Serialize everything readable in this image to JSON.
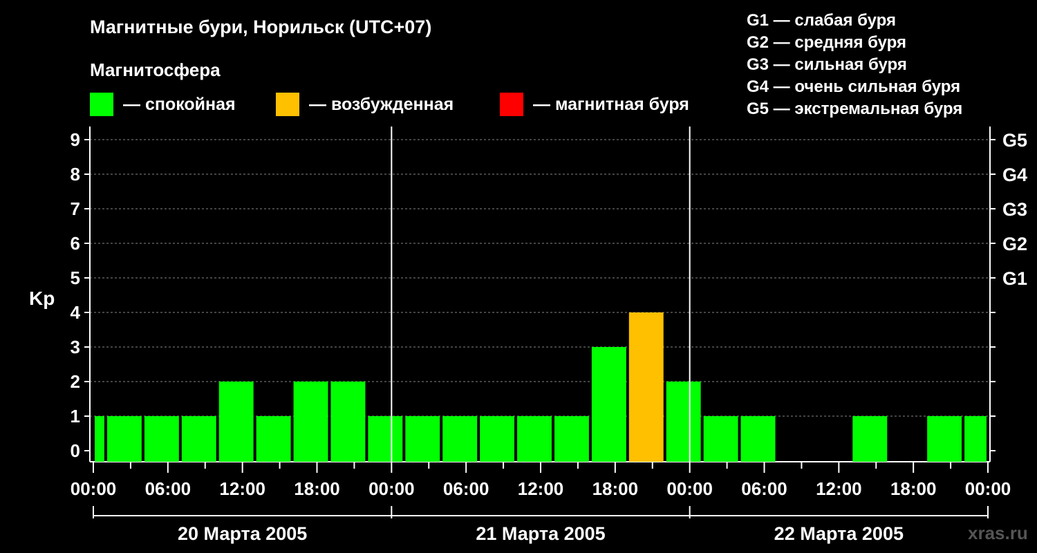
{
  "title": "Магнитные бури, Норильск (UTC+07)",
  "subtitle": "Магнитосфера",
  "legend": [
    {
      "label": "— спокойная",
      "color": "#00ff00"
    },
    {
      "label": "— возбужденная",
      "color": "#ffc000"
    },
    {
      "label": "— магнитная буря",
      "color": "#ff0000"
    }
  ],
  "g_scale": [
    "G1 — слабая буря",
    "G2 — средняя буря",
    "G3 — сильная буря",
    "G4 — очень сильная буря",
    "G5 — экстремальная буря"
  ],
  "watermark": "xras.ru",
  "chart_data": {
    "type": "bar",
    "ylabel": "Kp",
    "ylim": [
      0,
      9
    ],
    "yticks": [
      "0",
      "1",
      "2",
      "3",
      "4",
      "5",
      "6",
      "7",
      "8",
      "9"
    ],
    "right_ticks": [
      {
        "value": 5,
        "label": "G1"
      },
      {
        "value": 6,
        "label": "G2"
      },
      {
        "value": 7,
        "label": "G3"
      },
      {
        "value": 8,
        "label": "G4"
      },
      {
        "value": 9,
        "label": "G5"
      }
    ],
    "grid": "dashed horizontal",
    "xticks": [
      "00:00",
      "06:00",
      "12:00",
      "18:00",
      "00:00",
      "06:00",
      "12:00",
      "18:00",
      "00:00",
      "06:00",
      "12:00",
      "18:00",
      "00:00"
    ],
    "days": [
      "20 Марта 2005",
      "21 Марта 2005",
      "22 Марта 2005"
    ],
    "bars": [
      {
        "start": "20 Марта 2005 00:00",
        "end": "20 Марта 2005 01:00",
        "kp": 1,
        "level": "quiet"
      },
      {
        "start": "20 Марта 2005 01:00",
        "end": "20 Марта 2005 04:00",
        "kp": 1,
        "level": "quiet"
      },
      {
        "start": "20 Марта 2005 04:00",
        "end": "20 Марта 2005 07:00",
        "kp": 1,
        "level": "quiet"
      },
      {
        "start": "20 Марта 2005 07:00",
        "end": "20 Марта 2005 10:00",
        "kp": 1,
        "level": "quiet"
      },
      {
        "start": "20 Марта 2005 10:00",
        "end": "20 Марта 2005 13:00",
        "kp": 2,
        "level": "quiet"
      },
      {
        "start": "20 Марта 2005 13:00",
        "end": "20 Марта 2005 16:00",
        "kp": 1,
        "level": "quiet"
      },
      {
        "start": "20 Марта 2005 16:00",
        "end": "20 Марта 2005 19:00",
        "kp": 2,
        "level": "quiet"
      },
      {
        "start": "20 Марта 2005 19:00",
        "end": "20 Марта 2005 22:00",
        "kp": 2,
        "level": "quiet"
      },
      {
        "start": "20 Марта 2005 22:00",
        "end": "21 Марта 2005 01:00",
        "kp": 1,
        "level": "quiet"
      },
      {
        "start": "21 Марта 2005 01:00",
        "end": "21 Марта 2005 04:00",
        "kp": 1,
        "level": "quiet"
      },
      {
        "start": "21 Марта 2005 04:00",
        "end": "21 Марта 2005 07:00",
        "kp": 1,
        "level": "quiet"
      },
      {
        "start": "21 Марта 2005 07:00",
        "end": "21 Марта 2005 10:00",
        "kp": 1,
        "level": "quiet"
      },
      {
        "start": "21 Марта 2005 10:00",
        "end": "21 Марта 2005 13:00",
        "kp": 1,
        "level": "quiet"
      },
      {
        "start": "21 Марта 2005 13:00",
        "end": "21 Марта 2005 16:00",
        "kp": 1,
        "level": "quiet"
      },
      {
        "start": "21 Марта 2005 16:00",
        "end": "21 Марта 2005 19:00",
        "kp": 3,
        "level": "quiet"
      },
      {
        "start": "21 Марта 2005 19:00",
        "end": "21 Марта 2005 22:00",
        "kp": 4,
        "level": "active"
      },
      {
        "start": "21 Марта 2005 22:00",
        "end": "22 Марта 2005 01:00",
        "kp": 2,
        "level": "quiet"
      },
      {
        "start": "22 Марта 2005 01:00",
        "end": "22 Марта 2005 04:00",
        "kp": 1,
        "level": "quiet"
      },
      {
        "start": "22 Марта 2005 04:00",
        "end": "22 Марта 2005 07:00",
        "kp": 1,
        "level": "quiet"
      },
      {
        "start": "22 Марта 2005 13:00",
        "end": "22 Марта 2005 16:00",
        "kp": 1,
        "level": "quiet"
      },
      {
        "start": "22 Марта 2005 19:00",
        "end": "22 Марта 2005 22:00",
        "kp": 1,
        "level": "quiet"
      },
      {
        "start": "22 Марта 2005 22:00",
        "end": "23 Марта 2005 00:00",
        "kp": 1,
        "level": "quiet"
      }
    ],
    "level_colors": {
      "quiet": "#00ff00",
      "active": "#ffc000",
      "storm": "#ff0000"
    }
  }
}
